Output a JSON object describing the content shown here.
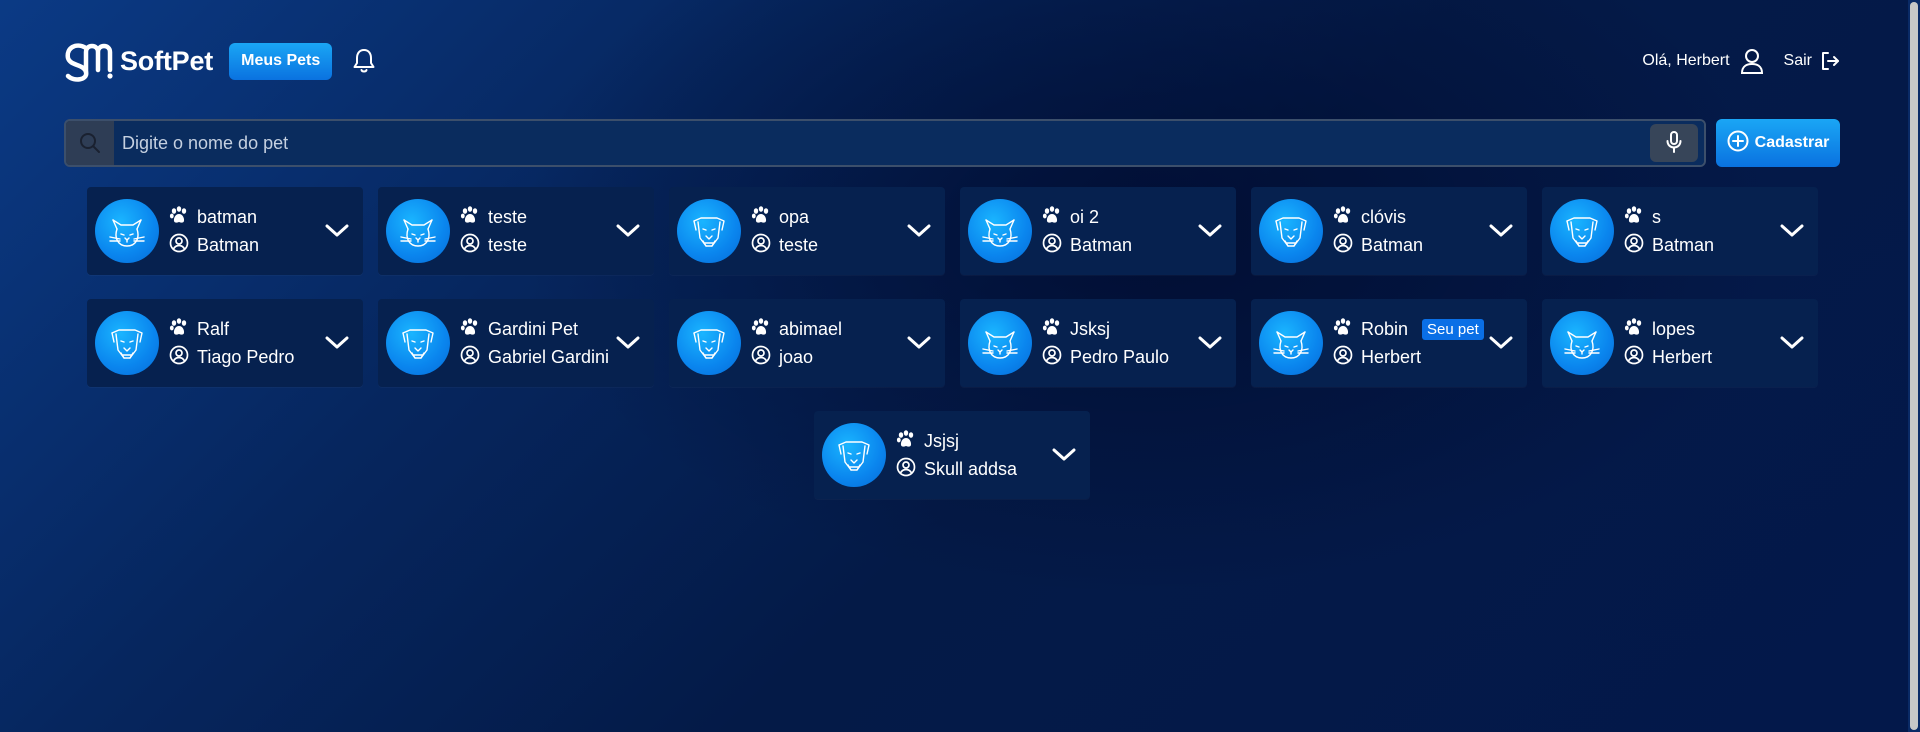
{
  "brand": {
    "name": "SoftPet"
  },
  "header": {
    "meus_pets_label": "Meus Pets",
    "greeting": "Olá, Herbert",
    "logout_label": "Sair"
  },
  "search": {
    "placeholder": "Digite o nome do pet",
    "value": ""
  },
  "cadastrar_label": "Cadastrar",
  "colors": {
    "accent": "#0a85ee",
    "background_dark": "#041a47",
    "card_bg": "#06214f"
  },
  "pets": [
    {
      "name": "batman",
      "owner": "Batman",
      "avatar_icon": "cat-icon",
      "badge": ""
    },
    {
      "name": "teste",
      "owner": "teste",
      "avatar_icon": "cat-icon",
      "badge": ""
    },
    {
      "name": "opa",
      "owner": "teste",
      "avatar_icon": "dog-icon",
      "badge": ""
    },
    {
      "name": "oi 2",
      "owner": "Batman",
      "avatar_icon": "cat-icon",
      "badge": ""
    },
    {
      "name": "clóvis",
      "owner": "Batman",
      "avatar_icon": "dog-icon",
      "badge": ""
    },
    {
      "name": "s",
      "owner": "Batman",
      "avatar_icon": "dog-icon",
      "badge": ""
    },
    {
      "name": "Ralf",
      "owner": "Tiago Pedro",
      "avatar_icon": "dog-icon",
      "badge": ""
    },
    {
      "name": "Gardini Pet",
      "owner": "Gabriel Gardini",
      "avatar_icon": "dog-icon",
      "badge": ""
    },
    {
      "name": "abimael",
      "owner": "joao",
      "avatar_icon": "dog-icon",
      "badge": ""
    },
    {
      "name": "Jsksj",
      "owner": "Pedro Paulo",
      "avatar_icon": "cat-icon",
      "badge": ""
    },
    {
      "name": "Robin",
      "owner": "Herbert",
      "avatar_icon": "cat-icon",
      "badge": "Seu pet"
    },
    {
      "name": "lopes",
      "owner": "Herbert",
      "avatar_icon": "cat-icon",
      "badge": ""
    },
    {
      "name": "Jsjsj",
      "owner": "Skull addsa",
      "avatar_icon": "dog-icon",
      "badge": ""
    }
  ]
}
